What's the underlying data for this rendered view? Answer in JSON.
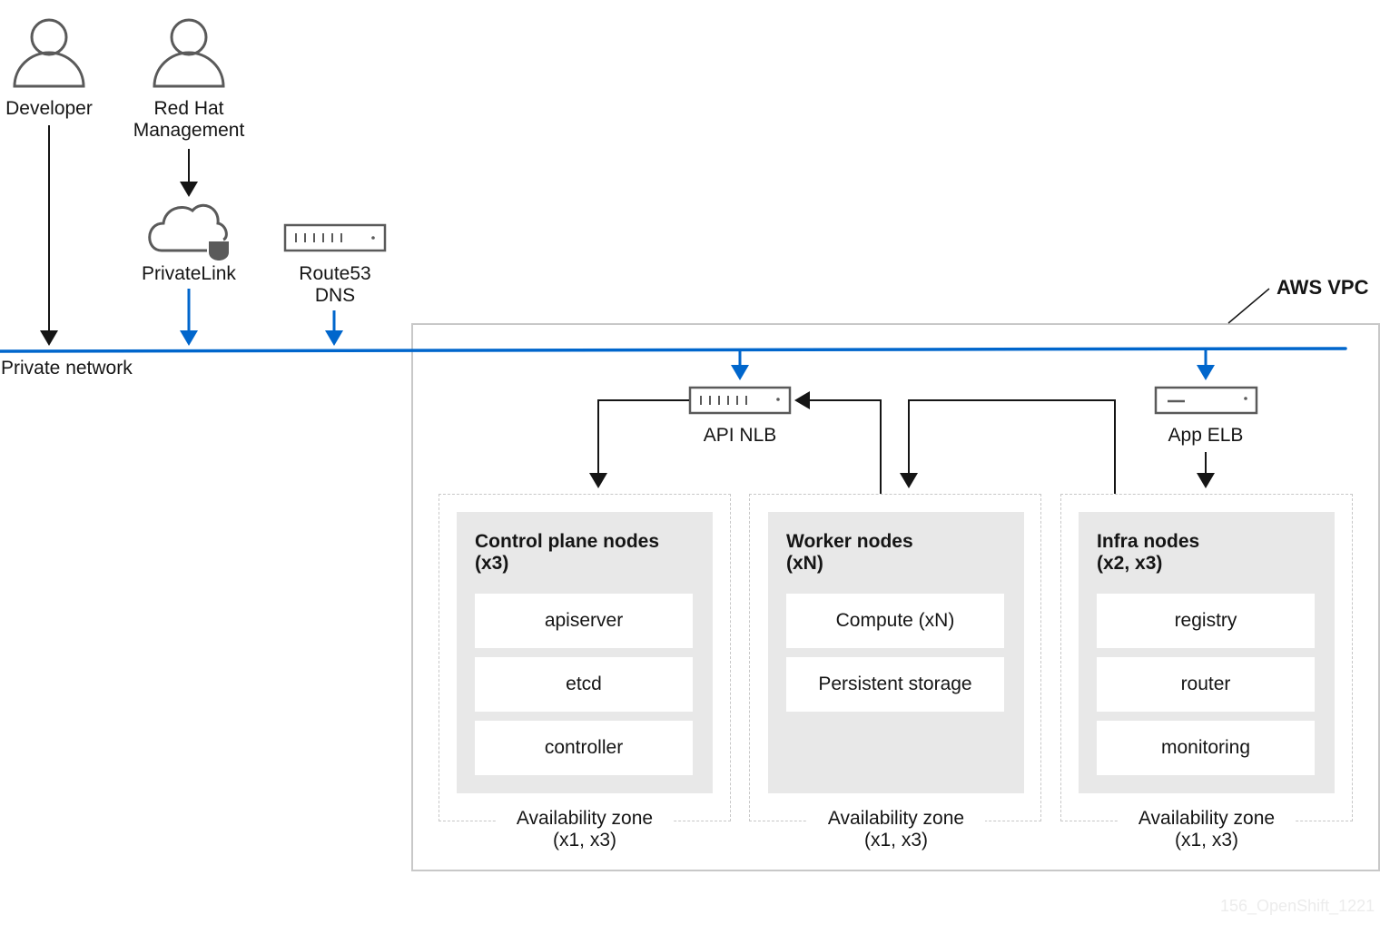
{
  "actors": [
    {
      "id": "developer",
      "label": "Developer",
      "icon": "user-icon"
    },
    {
      "id": "redhat",
      "label": "Red Hat\nManagement",
      "label_lines": [
        "Red Hat",
        "Management"
      ],
      "icon": "user-icon"
    }
  ],
  "services": {
    "privatelink": {
      "label": "PrivateLink",
      "icon": "cloud-shield-icon"
    },
    "route53": {
      "label_lines": [
        "Route53",
        "DNS"
      ],
      "icon": "load-balancer-icon"
    },
    "api_nlb": {
      "label": "API NLB",
      "icon": "load-balancer-icon"
    },
    "app_elb": {
      "label": "App ELB",
      "icon": "elb-icon"
    }
  },
  "network": {
    "label": "Private network",
    "color": "#0066cc"
  },
  "vpc": {
    "label": "AWS VPC"
  },
  "zones": [
    {
      "title_lines": [
        "Control plane nodes",
        "(x3)"
      ],
      "items": [
        "apiserver",
        "etcd",
        "controller"
      ],
      "caption_lines": [
        "Availability zone",
        "(x1, x3)"
      ]
    },
    {
      "title_lines": [
        "Worker nodes",
        "(xN)"
      ],
      "items": [
        "Compute (xN)",
        "Persistent storage"
      ],
      "caption_lines": [
        "Availability zone",
        "(x1, x3)"
      ]
    },
    {
      "title_lines": [
        "Infra nodes",
        "(x2, x3)"
      ],
      "items": [
        "registry",
        "router",
        "monitoring"
      ],
      "caption_lines": [
        "Availability zone",
        "(x1, x3)"
      ]
    }
  ],
  "colors": {
    "network_blue": "#0066cc",
    "arrow_black": "#151515",
    "icon_gray": "#5a5a5a",
    "node_bg": "#e8e8e8"
  },
  "watermark": "156_OpenShift_1221"
}
